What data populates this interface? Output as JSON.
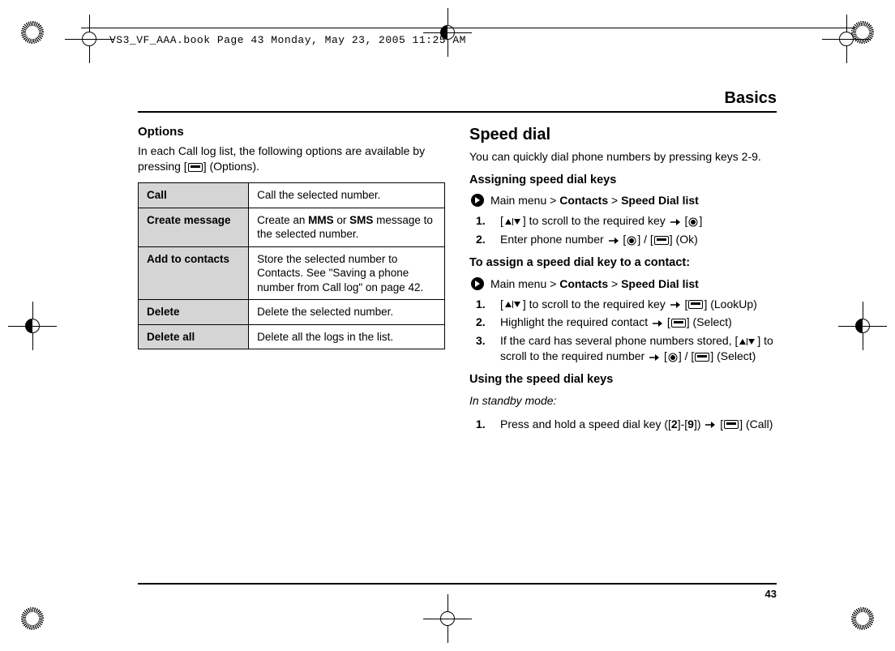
{
  "header_stamp": "VS3_VF_AAA.book  Page 43  Monday, May 23, 2005  11:25 AM",
  "section_title": "Basics",
  "page_number": "43",
  "left": {
    "heading": "Options",
    "intro_a": "In each Call log list, the following options are available by pressing [",
    "intro_b": "] (Options).",
    "table": [
      {
        "k": "Call",
        "v": "Call the selected number."
      },
      {
        "k": "Create message",
        "v_a": "Create an ",
        "v_b1": "MMS",
        "v_mid": " or ",
        "v_b2": "SMS",
        "v_c": " message to the selected number."
      },
      {
        "k": "Add to contacts",
        "v": "Store the selected number to Contacts. See \"Saving a phone number from Call log\" on page 42."
      },
      {
        "k": "Delete",
        "v": "Delete the selected number."
      },
      {
        "k": "Delete all",
        "v": "Delete all the logs in the list."
      }
    ]
  },
  "right": {
    "heading": "Speed dial",
    "intro": "You can quickly dial phone numbers by pressing keys 2-9.",
    "assign_heading": "Assigning speed dial keys",
    "nav1_a": "Main menu > ",
    "nav1_b1": "Contacts",
    "nav1_mid": " > ",
    "nav1_b2": "Speed Dial list",
    "assign_steps": {
      "s1_a": "[",
      "s1_b": "] to scroll to the required key ",
      "s1_c": " [",
      "s1_d": "]",
      "s2_a": "Enter phone number ",
      "s2_b": " [",
      "s2_mid": "] / [",
      "s2_c": "] (Ok)"
    },
    "contact_heading": "To assign a speed dial key to a contact:",
    "nav2_a": "Main menu > ",
    "nav2_b1": "Contacts",
    "nav2_mid": " > ",
    "nav2_b2": "Speed Dial list",
    "contact_steps": {
      "s1_a": "[",
      "s1_b": "] to scroll to the required key ",
      "s1_c": " [",
      "s1_d": "] (LookUp)",
      "s2_a": "Highlight the required contact ",
      "s2_b": " [",
      "s2_c": "] (Select)",
      "s3_a": "If the card has several phone numbers stored, [",
      "s3_b": "] to scroll to the required number ",
      "s3_c": " [",
      "s3_mid": "] / [",
      "s3_d": "] (Select)"
    },
    "using_heading": "Using the speed dial keys",
    "using_sub": "In standby mode:",
    "using_step_a": "Press and hold a speed dial key ([",
    "using_key_2": "2",
    "using_step_b": "]-[",
    "using_key_9": "9",
    "using_step_c": "]) ",
    "using_step_d": " [",
    "using_step_e": "] (Call)"
  }
}
